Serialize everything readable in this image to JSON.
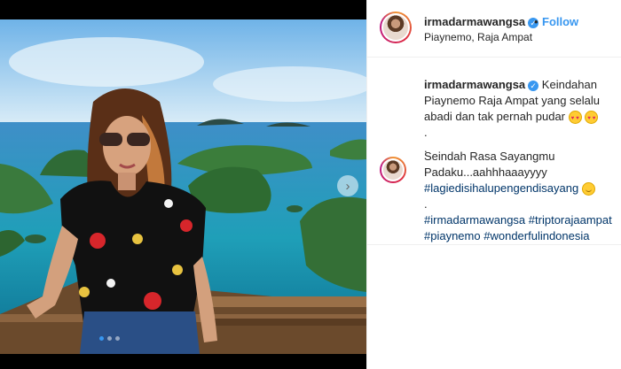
{
  "post": {
    "username": "irmadarmawangsa",
    "verified_icon": "verified-badge-icon",
    "separator": "•",
    "follow_label": "Follow",
    "location": "Piaynemo, Raja Ampat",
    "carousel": {
      "current": 1,
      "total": 3
    }
  },
  "caption": {
    "username": "irmadarmawangsa",
    "line1": "Keindahan Piaynemo Raja Ampat yang selalu abadi dan tak pernah pudar",
    "dot1": ".",
    "dot2": "."
  },
  "comment": {
    "text": "Seindah Rasa Sayangmu Padaku...aahhhaaayyyy",
    "hashtag1": "#lagiedisihalupengendisayang",
    "dot": ".",
    "hashtags": [
      "#irmadarmawangsa",
      "#triptorajaampat",
      "#piaynemo",
      "#wonderfulindonesia"
    ]
  },
  "colors": {
    "link_blue": "#3897f0",
    "hashtag_blue": "#003569",
    "text": "#262626"
  }
}
